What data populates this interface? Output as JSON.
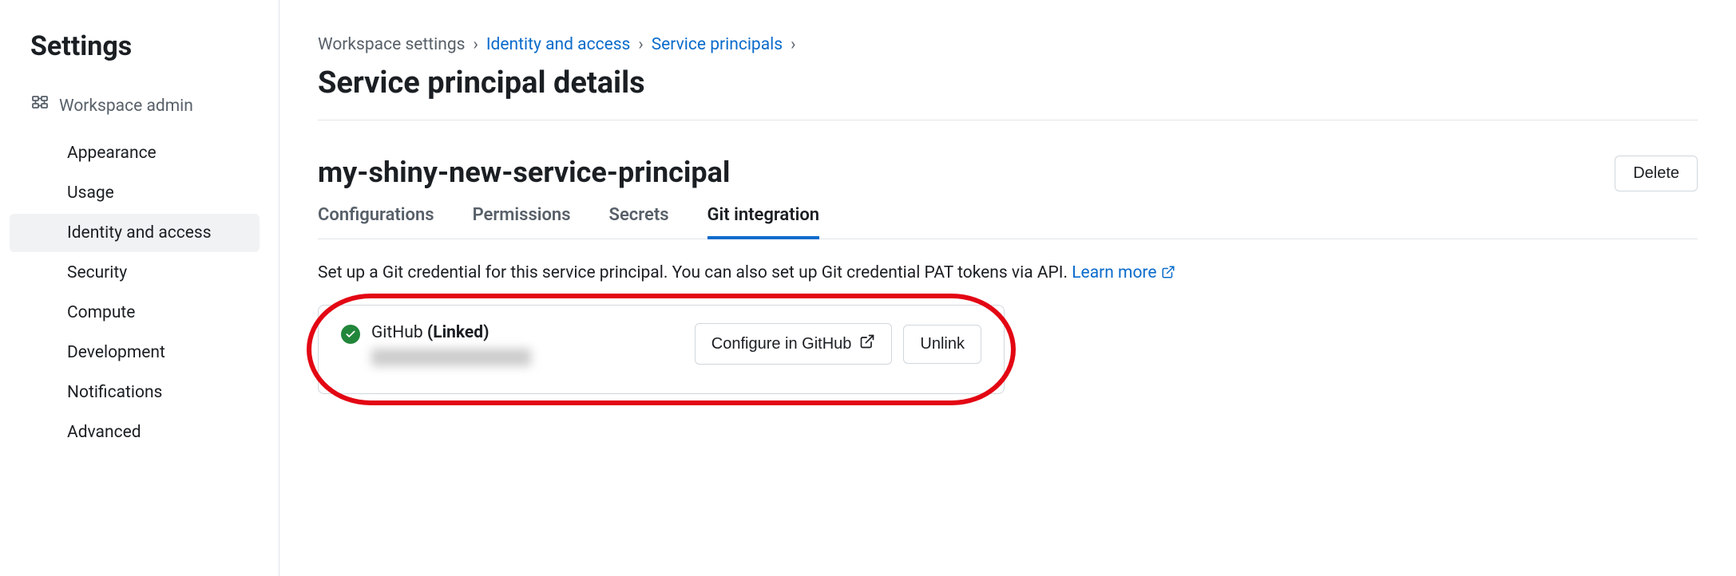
{
  "sidebar": {
    "title": "Settings",
    "section_label": "Workspace admin",
    "items": [
      {
        "label": "Appearance"
      },
      {
        "label": "Usage"
      },
      {
        "label": "Identity and access",
        "active": true
      },
      {
        "label": "Security"
      },
      {
        "label": "Compute"
      },
      {
        "label": "Development"
      },
      {
        "label": "Notifications"
      },
      {
        "label": "Advanced"
      }
    ]
  },
  "breadcrumb": {
    "items": [
      {
        "label": "Workspace settings",
        "link": false
      },
      {
        "label": "Identity and access",
        "link": true
      },
      {
        "label": "Service principals",
        "link": true
      }
    ]
  },
  "page_title": "Service principal details",
  "principal_name": "my-shiny-new-service-principal",
  "delete_label": "Delete",
  "tabs": [
    {
      "label": "Configurations"
    },
    {
      "label": "Permissions"
    },
    {
      "label": "Secrets"
    },
    {
      "label": "Git integration",
      "active": true
    }
  ],
  "description_text": "Set up a Git credential for this service principal. You can also set up Git credential PAT tokens via API. ",
  "learn_more_label": "Learn more",
  "git_card": {
    "provider": "GitHub",
    "status_label": "(Linked)",
    "configure_label": "Configure in GitHub",
    "unlink_label": "Unlink"
  }
}
